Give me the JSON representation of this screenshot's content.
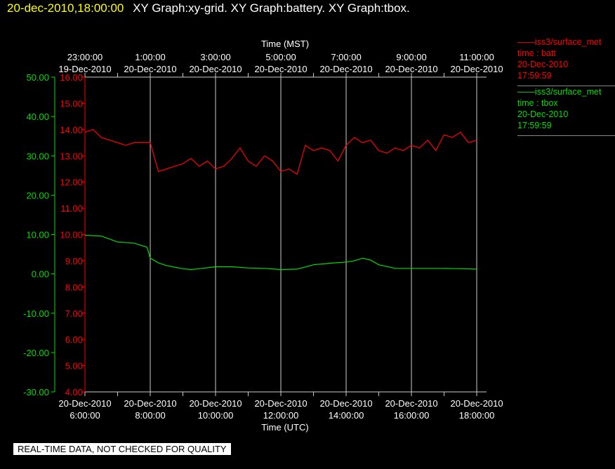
{
  "header": {
    "timestamp": "20-dec-2010,18:00:00",
    "titles": "XY Graph:xy-grid.  XY Graph:battery.  XY Graph:tbox."
  },
  "legend": [
    {
      "station": "iss3/surface_met",
      "variable": "time : batt",
      "date": "20-Dec-2010",
      "time": "17:59:59",
      "color": "#ff0000"
    },
    {
      "station": "iss3/surface_met",
      "variable": "time : tbox",
      "date": "20-Dec-2010",
      "time": "17:59:59",
      "color": "#00dd00"
    }
  ],
  "footer_note": "REAL-TIME DATA, NOT CHECKED FOR QUALITY",
  "chart_data": {
    "type": "line",
    "top_axis": {
      "label": "Time (MST)",
      "ticks": [
        {
          "time": "23:00:00",
          "date": "19-Dec-2010"
        },
        {
          "time": "1:00:00",
          "date": "20-Dec-2010"
        },
        {
          "time": "3:00:00",
          "date": "20-Dec-2010"
        },
        {
          "time": "5:00:00",
          "date": "20-Dec-2010"
        },
        {
          "time": "7:00:00",
          "date": "20-Dec-2010"
        },
        {
          "time": "9:00:00",
          "date": "20-Dec-2010"
        },
        {
          "time": "11:00:00",
          "date": "20-Dec-2010"
        }
      ]
    },
    "bottom_axis": {
      "label": "Time (UTC)",
      "ticks": [
        {
          "time": "6:00:00",
          "date": "20-Dec-2010"
        },
        {
          "time": "8:00:00",
          "date": "20-Dec-2010"
        },
        {
          "time": "10:00:00",
          "date": "20-Dec-2010"
        },
        {
          "time": "12:00:00",
          "date": "20-Dec-2010"
        },
        {
          "time": "14:00:00",
          "date": "20-Dec-2010"
        },
        {
          "time": "16:00:00",
          "date": "20-Dec-2010"
        },
        {
          "time": "18:00:00",
          "date": "20-Dec-2010"
        }
      ],
      "xlim_hours_utc": [
        6,
        18.3
      ]
    },
    "left_axis": {
      "color": "#00dd00",
      "ylim": [
        -30,
        50
      ],
      "tick_labels": [
        "50.00",
        "40.00",
        "30.00",
        "20.00",
        "10.00",
        "0.00",
        "-10.00",
        "-20.00",
        "-30.00"
      ]
    },
    "right_axis": {
      "color": "#ff0000",
      "ylim": [
        4,
        16
      ],
      "tick_labels": [
        "16.00",
        "15.00",
        "14.00",
        "13.00",
        "12.00",
        "11.00",
        "10.00",
        "9.00",
        "8.00",
        "7.00",
        "6.00",
        "5.00",
        "4.00"
      ]
    },
    "grid": true,
    "series": [
      {
        "name": "time : batt",
        "axis": "right",
        "color": "#ff0000",
        "x": [
          6.0,
          6.25,
          6.5,
          6.75,
          7.0,
          7.25,
          7.5,
          7.75,
          8.0,
          8.25,
          8.5,
          8.75,
          9.0,
          9.25,
          9.5,
          9.75,
          10.0,
          10.25,
          10.5,
          10.75,
          11.0,
          11.25,
          11.5,
          11.75,
          12.0,
          12.25,
          12.5,
          12.75,
          13.0,
          13.25,
          13.5,
          13.75,
          14.0,
          14.25,
          14.5,
          14.75,
          15.0,
          15.25,
          15.5,
          15.75,
          16.0,
          16.25,
          16.5,
          16.75,
          17.0,
          17.25,
          17.5,
          17.75,
          18.0
        ],
        "y": [
          13.9,
          14.0,
          13.7,
          13.6,
          13.5,
          13.4,
          13.5,
          13.5,
          13.5,
          12.4,
          12.5,
          12.6,
          12.7,
          12.9,
          12.6,
          12.8,
          12.5,
          12.6,
          12.9,
          13.3,
          12.8,
          12.6,
          13.0,
          12.8,
          12.4,
          12.5,
          12.3,
          13.4,
          13.2,
          13.3,
          13.2,
          12.8,
          13.4,
          13.7,
          13.5,
          13.6,
          13.2,
          13.1,
          13.3,
          13.2,
          13.4,
          13.3,
          13.6,
          13.2,
          13.8,
          13.7,
          13.9,
          13.5,
          13.6
        ]
      },
      {
        "name": "time : tbox",
        "axis": "left",
        "color": "#00dd00",
        "x": [
          6.0,
          6.5,
          7.0,
          7.5,
          7.9,
          8.0,
          8.25,
          8.5,
          8.75,
          9.0,
          9.25,
          9.5,
          10.0,
          10.5,
          11.0,
          11.5,
          12.0,
          12.5,
          13.0,
          13.5,
          14.0,
          14.25,
          14.5,
          14.75,
          15.0,
          15.5,
          16.0,
          16.5,
          17.0,
          17.5,
          18.0
        ],
        "y": [
          9.8,
          9.6,
          8.1,
          7.8,
          6.8,
          4.0,
          2.8,
          2.1,
          1.7,
          1.3,
          1.1,
          1.3,
          1.8,
          1.8,
          1.5,
          1.4,
          1.1,
          1.2,
          2.3,
          2.7,
          3.0,
          3.3,
          4.0,
          3.5,
          2.3,
          1.4,
          1.4,
          1.4,
          1.4,
          1.3,
          1.2
        ]
      }
    ]
  }
}
